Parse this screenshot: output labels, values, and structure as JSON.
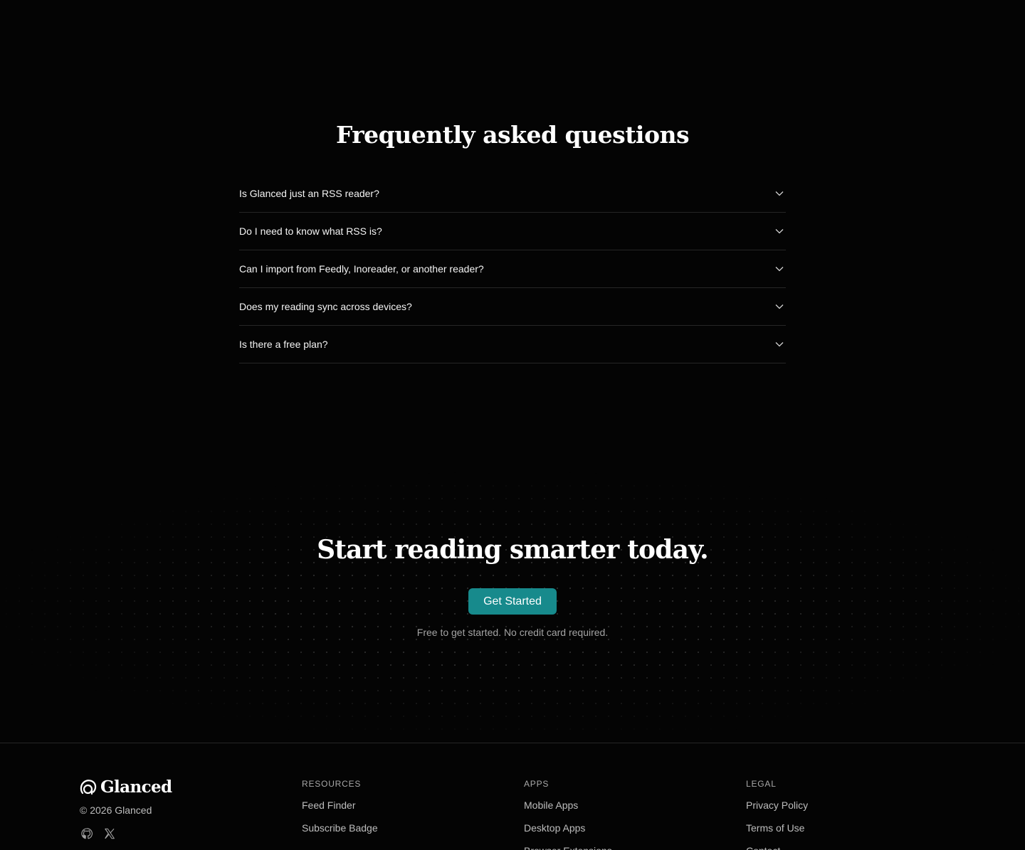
{
  "faq": {
    "title": "Frequently asked questions",
    "items": [
      {
        "question": "Is Glanced just an RSS reader?"
      },
      {
        "question": "Do I need to know what RSS is?"
      },
      {
        "question": "Can I import from Feedly, Inoreader, or another reader?"
      },
      {
        "question": "Does my reading sync across devices?"
      },
      {
        "question": "Is there a free plan?"
      }
    ]
  },
  "cta": {
    "title": "Start reading smarter today.",
    "button_label": "Get Started",
    "note": "Free to get started. No credit card required.",
    "accent_color": "#178a8c"
  },
  "footer": {
    "brand_name": "Glanced",
    "copyright": "© 2026 Glanced",
    "socials": [
      {
        "icon": "github-icon"
      },
      {
        "icon": "x-icon"
      }
    ],
    "columns": [
      {
        "heading": "RESOURCES",
        "links": [
          "Feed Finder",
          "Subscribe Badge"
        ]
      },
      {
        "heading": "APPS",
        "links": [
          "Mobile Apps",
          "Desktop Apps",
          "Browser Extensions"
        ]
      },
      {
        "heading": "LEGAL",
        "links": [
          "Privacy Policy",
          "Terms of Use",
          "Contact"
        ]
      }
    ]
  }
}
